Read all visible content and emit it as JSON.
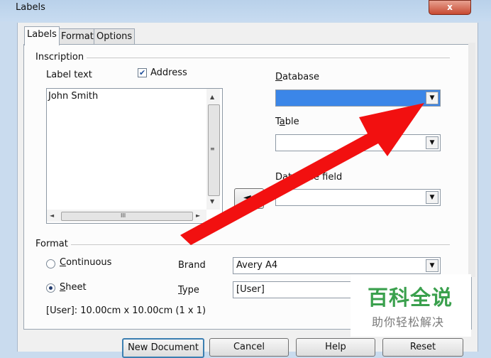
{
  "window": {
    "title": "Labels",
    "close": "x"
  },
  "tabs": [
    {
      "label": "Labels"
    },
    {
      "label": "Format"
    },
    {
      "label": "Options"
    }
  ],
  "inscription": {
    "group_label": "Inscription",
    "label_text_label": "Label text",
    "address_checkbox": {
      "label": "Address",
      "checked": true
    },
    "text": "John Smith",
    "scroll_up": "▲",
    "scroll_down": "▼",
    "scroll_left": "◄",
    "scroll_right": "►",
    "scroll_grip_v": "≡",
    "scroll_grip_h": "III",
    "database_label": "Database",
    "database_value": "",
    "table_label": "Table",
    "table_value": "",
    "database_field_label": "Database field",
    "database_field_value": "",
    "insert_arrow": "◄",
    "dropdown_glyph": "▼"
  },
  "format": {
    "group_label": "Format",
    "continuous_label": "Continuous",
    "sheet_label": "Sheet",
    "selected": "sheet",
    "brand_label": "Brand",
    "brand_value": "Avery A4",
    "type_label": "Type",
    "type_value": "[User]",
    "size_info": "[User]: 10.00cm x 10.00cm (1 x 1)"
  },
  "buttons": {
    "new_document": "New Document",
    "cancel": "Cancel",
    "help": "Help",
    "reset": "Reset"
  },
  "watermark": {
    "line1": "百科全说",
    "line2": "助你轻松解决"
  },
  "colors": {
    "database_selected": "#3b86e8",
    "annotation_arrow": "#f21010",
    "watermark_green": "#3aa04d"
  }
}
